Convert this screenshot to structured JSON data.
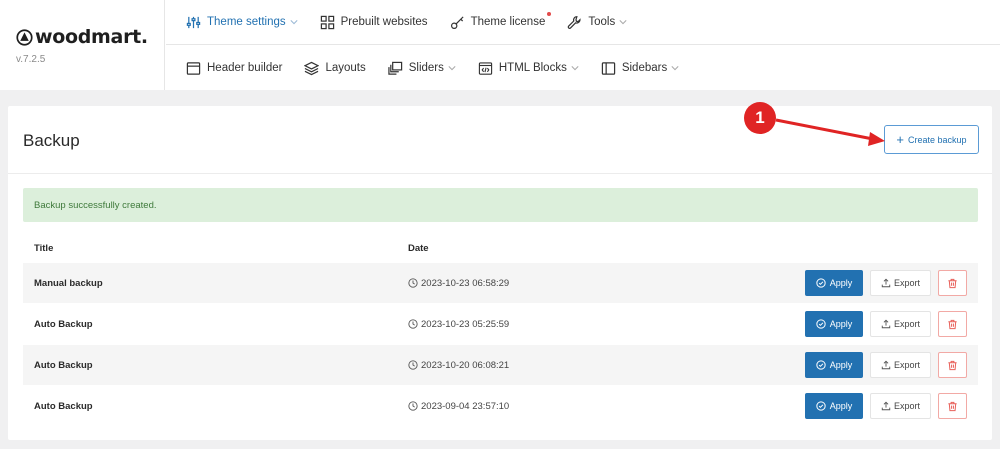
{
  "brand": {
    "name": "woodmart.",
    "version": "v.7.2.5"
  },
  "nav": {
    "row1": [
      {
        "label": "Theme settings",
        "icon": "sliders-icon",
        "active": true,
        "dropdown": true
      },
      {
        "label": "Prebuilt websites",
        "icon": "grid-icon",
        "dropdown": false
      },
      {
        "label": "Theme license",
        "icon": "key-icon",
        "dropdown": false,
        "dot": true
      },
      {
        "label": "Tools",
        "icon": "wrench-icon",
        "dropdown": true
      }
    ],
    "row2": [
      {
        "label": "Header builder",
        "icon": "header-icon",
        "dropdown": false
      },
      {
        "label": "Layouts",
        "icon": "layers-icon",
        "dropdown": false
      },
      {
        "label": "Sliders",
        "icon": "sliders-stack-icon",
        "dropdown": true
      },
      {
        "label": "HTML Blocks",
        "icon": "code-block-icon",
        "dropdown": true
      },
      {
        "label": "Sidebars",
        "icon": "sidebar-icon",
        "dropdown": true
      }
    ]
  },
  "panel": {
    "title": "Backup",
    "create_label": "Create backup",
    "notice": "Backup successfully created.",
    "columns": {
      "title": "Title",
      "date": "Date"
    },
    "rows": [
      {
        "title": "Manual backup",
        "date": "2023-10-23 06:58:29"
      },
      {
        "title": "Auto Backup",
        "date": "2023-10-23 05:25:59"
      },
      {
        "title": "Auto Backup",
        "date": "2023-10-20 06:08:21"
      },
      {
        "title": "Auto Backup",
        "date": "2023-09-04 23:57:10"
      }
    ],
    "apply_label": "Apply",
    "export_label": "Export"
  },
  "annotation": {
    "number": "1"
  },
  "colors": {
    "accent": "#2271b1",
    "notice_bg": "#dcefdb",
    "annotation": "#e02424",
    "delete": "#e8605a"
  }
}
